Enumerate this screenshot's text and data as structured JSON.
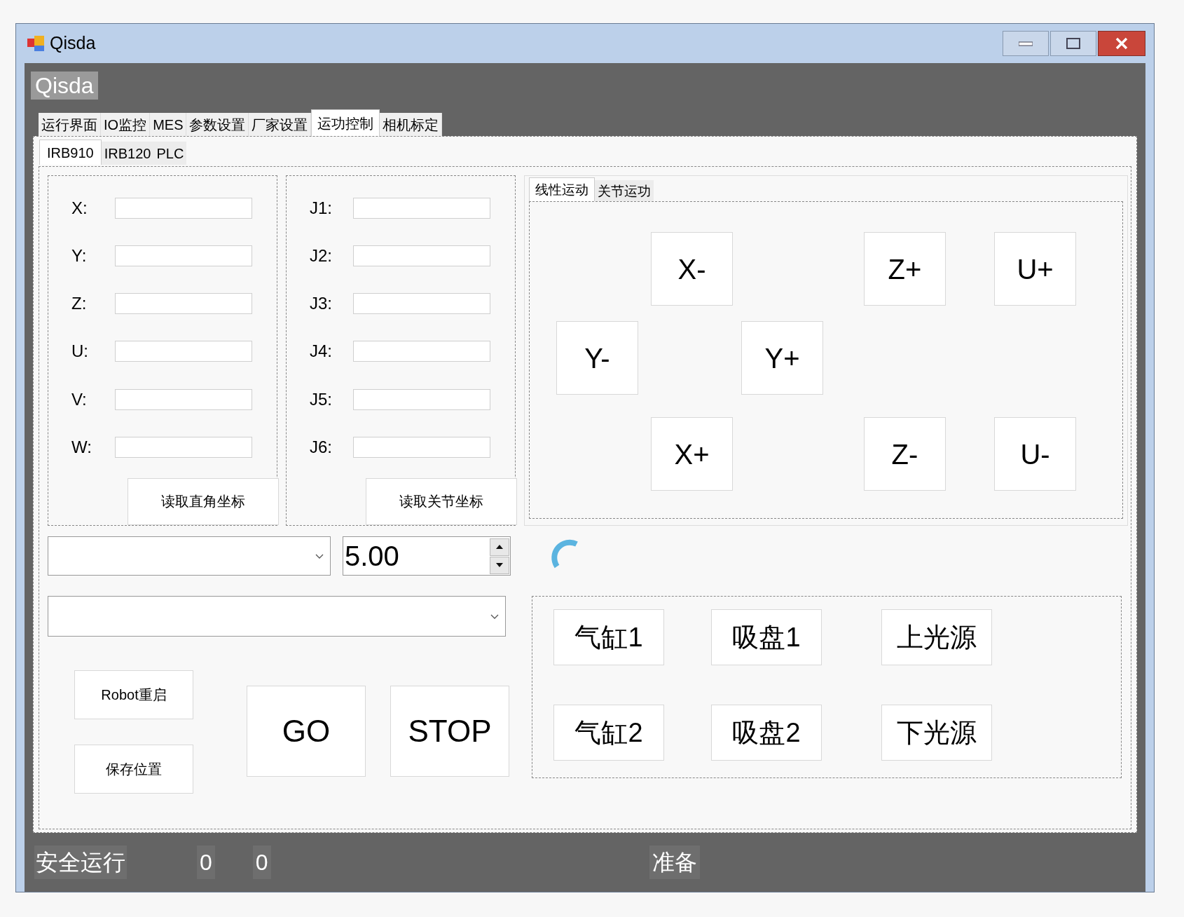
{
  "window": {
    "title": "Qisda"
  },
  "header": {
    "label": "Qisda"
  },
  "tabs": [
    {
      "label": "运行界面",
      "selected": false
    },
    {
      "label": "IO监控",
      "selected": false
    },
    {
      "label": "MES",
      "selected": false
    },
    {
      "label": "参数设置",
      "selected": false
    },
    {
      "label": "厂家设置",
      "selected": false
    },
    {
      "label": "运功控制",
      "selected": true
    },
    {
      "label": "相机标定",
      "selected": false
    }
  ],
  "sub_tabs": [
    {
      "label": "IRB910",
      "selected": true
    },
    {
      "label": "IRB120",
      "selected": false
    },
    {
      "label": "PLC",
      "selected": false
    }
  ],
  "cartesian": {
    "fields": [
      {
        "label": "X:"
      },
      {
        "label": "Y:"
      },
      {
        "label": "Z:"
      },
      {
        "label": "U:"
      },
      {
        "label": "V:"
      },
      {
        "label": "W:"
      }
    ],
    "button": "读取直角坐标"
  },
  "joint": {
    "fields": [
      {
        "label": "J1:"
      },
      {
        "label": "J2:"
      },
      {
        "label": "J3:"
      },
      {
        "label": "J4:"
      },
      {
        "label": "J5:"
      },
      {
        "label": "J6:"
      }
    ],
    "button": "读取关节坐标"
  },
  "motion_tabs": [
    {
      "label": "线性运动",
      "selected": true
    },
    {
      "label": "关节运功",
      "selected": false
    }
  ],
  "jog_buttons": [
    "X-",
    "Z+",
    "U+",
    "Y-",
    "Y+",
    "X+",
    "Z-",
    "U-"
  ],
  "speed": {
    "value": "5.00"
  },
  "actions": [
    "Robot重启",
    "保存位置",
    "GO",
    "STOP"
  ],
  "io_buttons": [
    "气缸1",
    "吸盘1",
    "上光源",
    "气缸2",
    "吸盘2",
    "下光源"
  ],
  "status_bar": [
    "安全运行",
    "0",
    "0",
    "准备"
  ]
}
